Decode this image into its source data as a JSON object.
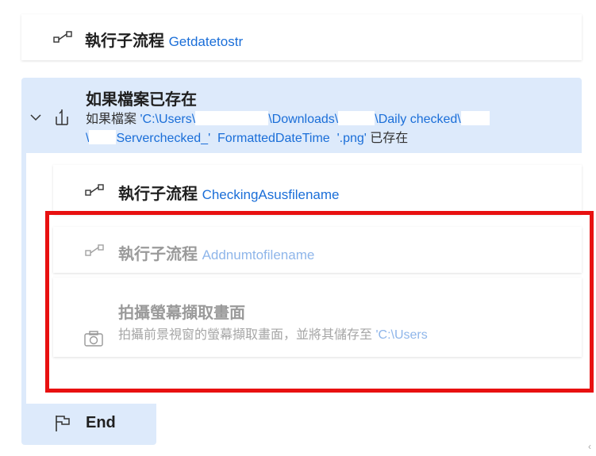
{
  "steps": {
    "getdate": {
      "action": "執行子流程",
      "name": "Getdatetostr",
      "icon": "subflow-icon"
    },
    "if_file_exists": {
      "title": "如果檔案已存在",
      "desc_prefix": "如果檔案",
      "path_1": "'C:\\Users\\",
      "path_2": "\\Downloads\\",
      "path_3": "\\Daily checked\\",
      "path_4": "\\",
      "path_5": "Serverchecked_'",
      "var": "FormattedDateTime",
      "path_6": "'.png'",
      "desc_suffix": "已存在",
      "icon": "if-icon",
      "toggle_icon": "chevron-down-icon"
    },
    "checking": {
      "action": "執行子流程",
      "name": "CheckingAsusfilename",
      "icon": "subflow-icon"
    },
    "addnum": {
      "action": "執行子流程",
      "name": "Addnumtofilename",
      "icon": "subflow-icon"
    },
    "screenshot": {
      "title": "拍攝螢幕擷取畫面",
      "desc": "拍攝前景視窗的螢幕擷取畫面，並將其儲存至",
      "path": "'C:\\Users",
      "icon": "camera-icon"
    },
    "end": {
      "label": "End",
      "icon": "flag-icon"
    }
  },
  "colors": {
    "accent": "#1a6ed8",
    "block_bg": "#ddeafb",
    "highlight": "#e81010",
    "disabled_text": "#9a9a9a"
  }
}
